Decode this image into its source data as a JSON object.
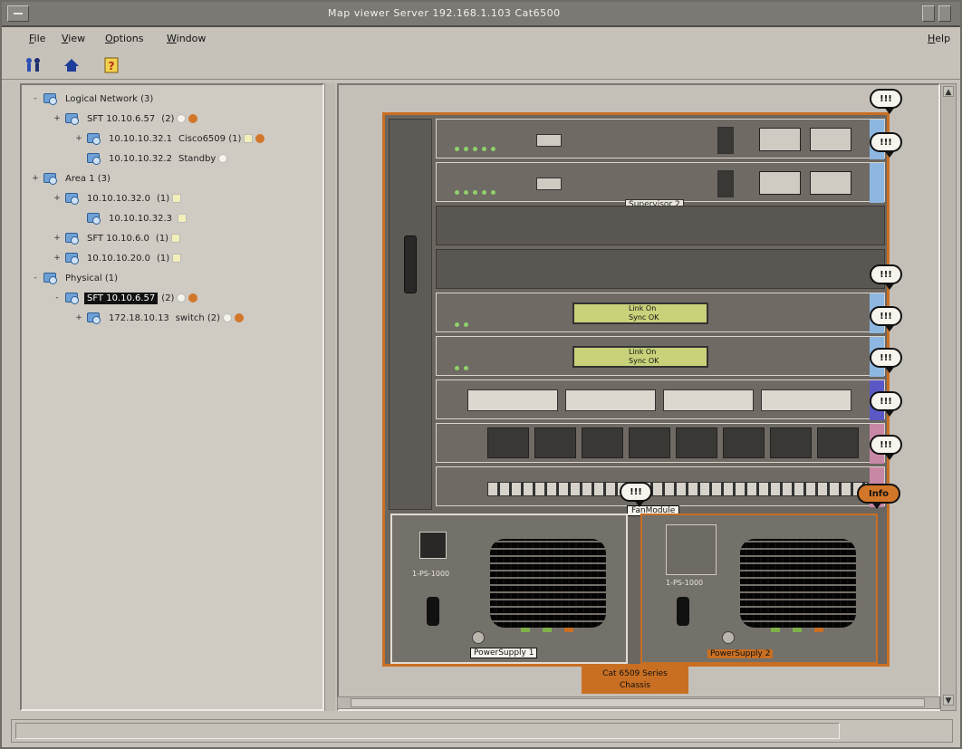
{
  "window": {
    "title": "Map viewer    Server 192.168.1.103   Cat6500"
  },
  "menubar": {
    "items": [
      "File",
      "View",
      "Options",
      "Window"
    ],
    "help": "Help"
  },
  "toolbar": {
    "tools": [
      {
        "name": "discover-icon",
        "glyph": "⚲"
      },
      {
        "name": "home-icon",
        "glyph": "⌂"
      },
      {
        "name": "help-icon",
        "glyph": "?"
      }
    ]
  },
  "tree": {
    "nodes": [
      {
        "label": "Logical Network (3)",
        "indent": 0,
        "expander": "-",
        "dots": []
      },
      {
        "label": "SFT 10.10.6.57",
        "indent": 1,
        "expander": "+",
        "dots": [
          "white",
          "orange"
        ],
        "suffix": "(2)"
      },
      {
        "label": "10.10.10.32.1",
        "indent": 2,
        "expander": "+",
        "dots": [
          "yellow",
          "orange"
        ],
        "suffix": "Cisco6509 (1)"
      },
      {
        "label": "10.10.10.32.2",
        "indent": 2,
        "expander": "",
        "dots": [
          "white"
        ],
        "suffix": "Standby"
      },
      {
        "label": "Area 1 (3)",
        "indent": 0,
        "expander": "+",
        "dots": []
      },
      {
        "label": "10.10.10.32.0",
        "indent": 1,
        "expander": "+",
        "dots": [
          "yellow"
        ],
        "suffix": "(1)"
      },
      {
        "label": "10.10.10.32.3",
        "indent": 2,
        "expander": "",
        "dots": [
          "yellow"
        ],
        "suffix": ""
      },
      {
        "label": "SFT 10.10.6.0",
        "indent": 1,
        "expander": "+",
        "dots": [
          "yellow"
        ],
        "suffix": "(1)"
      },
      {
        "label": "10.10.10.20.0",
        "indent": 1,
        "expander": "+",
        "dots": [
          "yellow"
        ],
        "suffix": "(1)"
      },
      {
        "label": "Physical (1)",
        "indent": 0,
        "expander": "-",
        "dots": []
      },
      {
        "label": "SFT 10.10.6.57",
        "indent": 1,
        "expander": "-",
        "dots": [
          "white",
          "orange"
        ],
        "suffix": "(2)",
        "selected": true
      },
      {
        "label": "172.18.10.13",
        "indent": 2,
        "expander": "+",
        "dots": [
          "white",
          "orange"
        ],
        "suffix": "switch (2)"
      }
    ]
  },
  "chassis": {
    "slot_labels": {
      "supervisor": "Supervisor 2",
      "empty_a": "",
      "fan_tag": "FanModule",
      "psu1": "PowerSupply 1",
      "psu2": "PowerSupply 2",
      "psu1_id": "1-PS-1000",
      "psu2_id": "1-PS-1000"
    },
    "lcd_lines": [
      "Link On",
      "Sync OK"
    ],
    "chassis_caption_1": "Cat 6509 Series",
    "chassis_caption_2": "Chassis",
    "callouts": [
      "!!!",
      "!!!",
      "!!!",
      "!!!",
      "!!!",
      "!!!",
      "!!!",
      "!!!",
      "!!!",
      "Info"
    ]
  },
  "colors": {
    "accent": "#c96f23",
    "tab_blue": "#8db7e0",
    "tab_purple": "#5b58c6",
    "tab_pink": "#c987a6"
  }
}
